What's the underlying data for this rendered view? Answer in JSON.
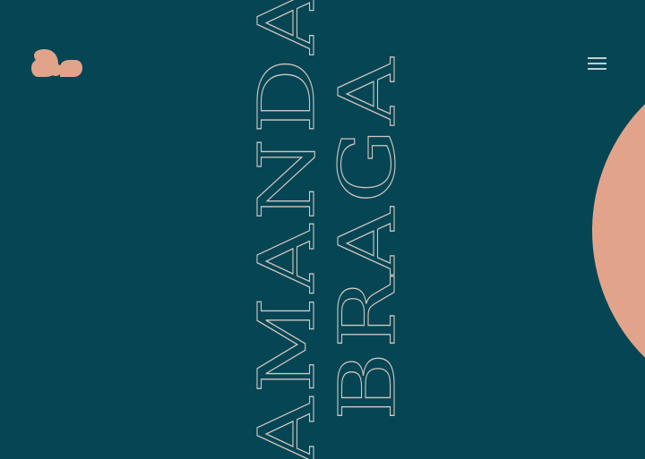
{
  "colors": {
    "background": "#064554",
    "accent": "#e1a48a",
    "outline_text": "#cfc7bf",
    "menu_icon": "#ffffff"
  },
  "header": {
    "logo_icon": "ab-monogram-logo",
    "menu_icon": "hamburger-menu-icon"
  },
  "hero": {
    "first_name": "AMANDA",
    "last_name": "BRAGA"
  }
}
